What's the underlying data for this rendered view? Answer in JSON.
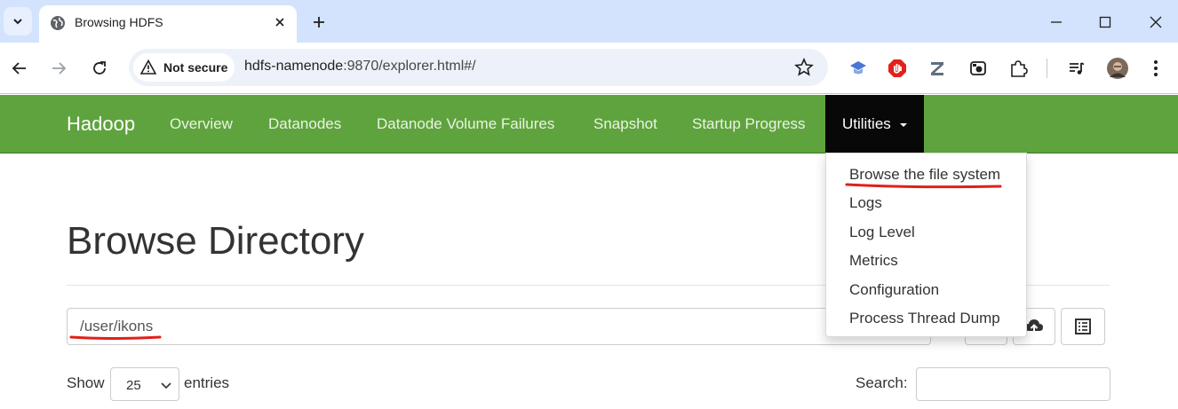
{
  "browser": {
    "tab_title": "Browsing HDFS",
    "security_label": "Not secure",
    "url_host": "hdfs-namenode",
    "url_rest": ":9870/explorer.html#/"
  },
  "navbar": {
    "brand": "Hadoop",
    "links": [
      "Overview",
      "Datanodes",
      "Datanode Volume Failures",
      "Snapshot",
      "Startup Progress"
    ],
    "active_menu": "Utilities",
    "color": "#5fa33e"
  },
  "dropdown": {
    "items": [
      "Browse the file system",
      "Logs",
      "Log Level",
      "Metrics",
      "Configuration",
      "Process Thread Dump"
    ]
  },
  "main": {
    "title": "Browse Directory",
    "directory_value": "/user/ikons",
    "show_label": "Show",
    "entries_value": "25",
    "entries_label": "entries",
    "search_label": "Search:"
  },
  "annotation_color": "#e0201b"
}
